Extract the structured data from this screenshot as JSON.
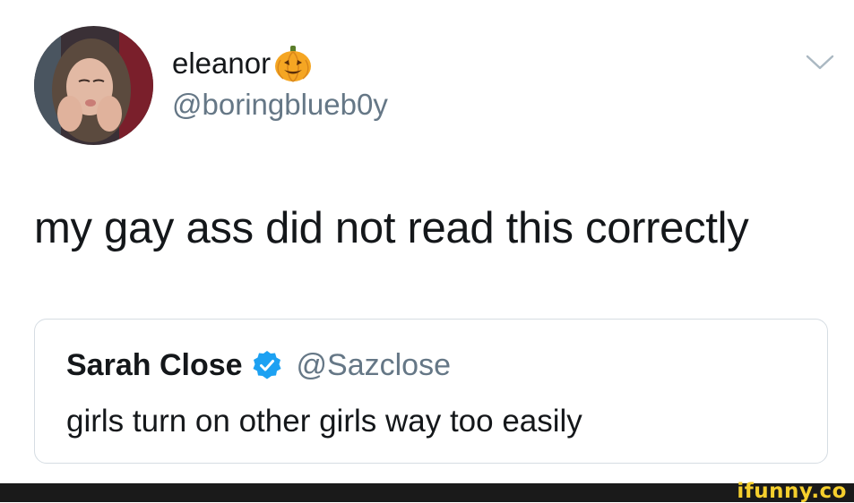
{
  "tweet": {
    "display_name": "eleanor",
    "name_emoji": "pumpkin-icon",
    "handle": "@boringblueb0y",
    "menu_icon": "chevron-down-icon",
    "text": "my gay ass did not read this correctly"
  },
  "quoted_tweet": {
    "display_name": "Sarah Close",
    "verified_icon": "verified-badge-icon",
    "handle": "@Sazclose",
    "text": "girls turn on other girls way too easily"
  },
  "footer": {
    "watermark": "ifunny.co"
  },
  "colors": {
    "text": "#14171a",
    "secondary_text": "#657786",
    "verified_blue": "#1da1f2",
    "pumpkin_orange": "#f5a623",
    "footer_bg": "#1a1a1a",
    "watermark_yellow": "#f5cf2d"
  }
}
